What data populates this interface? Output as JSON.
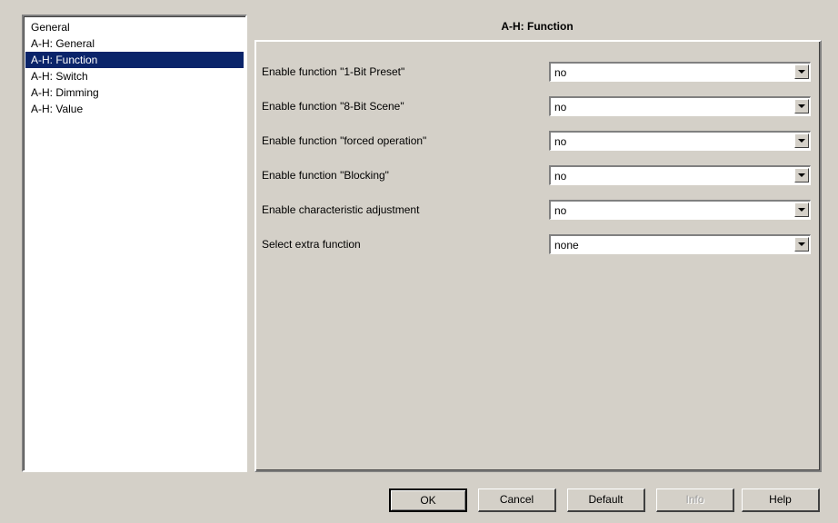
{
  "sidebar": {
    "items": [
      {
        "label": "General",
        "selected": false
      },
      {
        "label": "A-H: General",
        "selected": false
      },
      {
        "label": "A-H: Function",
        "selected": true
      },
      {
        "label": "A-H: Switch",
        "selected": false
      },
      {
        "label": "A-H: Dimming",
        "selected": false
      },
      {
        "label": "A-H: Value",
        "selected": false
      }
    ]
  },
  "page": {
    "title": "A-H: Function"
  },
  "params": [
    {
      "label": "Enable function \"1-Bit Preset\"",
      "value": "no"
    },
    {
      "label": "Enable function \"8-Bit Scene\"",
      "value": "no"
    },
    {
      "label": "Enable function \"forced operation\"",
      "value": "no"
    },
    {
      "label": "Enable function \"Blocking\"",
      "value": "no"
    },
    {
      "label": "Enable characteristic adjustment",
      "value": "no"
    },
    {
      "label": "Select extra function",
      "value": "none"
    }
  ],
  "buttons": {
    "ok": "OK",
    "cancel": "Cancel",
    "default": "Default",
    "info": "Info",
    "help": "Help"
  },
  "colors": {
    "dialog_bg": "#d4d0c8",
    "selection": "#0a246a"
  },
  "icons": {
    "dropdown_arrow": "chevron-down-icon"
  }
}
